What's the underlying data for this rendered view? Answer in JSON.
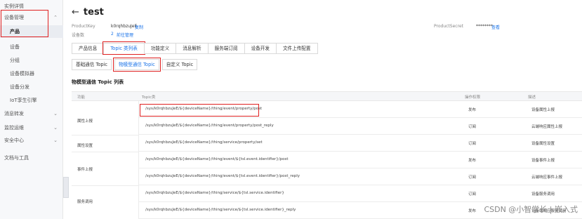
{
  "sidebar": {
    "items": [
      {
        "label": "实例详情"
      },
      {
        "label": "设备管理"
      },
      {
        "label": "产品"
      },
      {
        "label": "设备"
      },
      {
        "label": "分组"
      },
      {
        "label": "设备模拟器"
      },
      {
        "label": "设备分发"
      },
      {
        "label": "IoT孪生引擎"
      },
      {
        "label": "消息转发"
      },
      {
        "label": "监控运维"
      },
      {
        "label": "安全中心"
      },
      {
        "label": "文档与工具"
      }
    ]
  },
  "header": {
    "back_icon": "arrow-left-icon",
    "title": "test",
    "product_key_label": "ProductKey",
    "product_key_value": "k0rqhbzuJeE",
    "copy_label": "复制",
    "device_count_label": "设备数",
    "device_count_value": "2",
    "manage_label": "前往管理",
    "product_secret_label": "ProductSecret",
    "product_secret_value": "********",
    "view_label": "查看"
  },
  "tabs": [
    "产品信息",
    "Topic 类列表",
    "功能定义",
    "消息解析",
    "服务端订阅",
    "设备开发",
    "文件上传配置"
  ],
  "active_tab": 1,
  "subtabs": [
    "基础通信 Topic",
    "物模型通信 Topic",
    "自定义 Topic"
  ],
  "active_subtab": 1,
  "section_title": "物模型通信 Topic 列表",
  "table": {
    "columns": [
      "功能",
      "Topic类",
      "操作权限",
      "描述"
    ],
    "groups": [
      {
        "function": "属性上报",
        "rows": 2
      },
      {
        "function": "属性设置",
        "rows": 1
      },
      {
        "function": "事件上报",
        "rows": 2
      },
      {
        "function": "服务调用",
        "rows": 2
      }
    ],
    "rows": [
      {
        "topic": "/sys/k0rqhbzuJeE/${deviceName}/thing/event/property/post",
        "permission": "发布",
        "desc": "设备属性上报"
      },
      {
        "topic": "/sys/k0rqhbzuJeE/${deviceName}/thing/event/property/post_reply",
        "permission": "订阅",
        "desc": "云端响应属性上报"
      },
      {
        "topic": "/sys/k0rqhbzuJeE/${deviceName}/thing/service/property/set",
        "permission": "订阅",
        "desc": "设备属性设置"
      },
      {
        "topic": "/sys/k0rqhbzuJeE/${deviceName}/thing/event/${tsl.event.identifier}/post",
        "permission": "发布",
        "desc": "设备事件上报"
      },
      {
        "topic": "/sys/k0rqhbzuJeE/${deviceName}/thing/event/${tsl.event.identifier}/post_reply",
        "permission": "订阅",
        "desc": "云端响应事件上报"
      },
      {
        "topic": "/sys/k0rqhbzuJeE/${deviceName}/thing/service/${tsl.service.identifier}",
        "permission": "订阅",
        "desc": "设备服务调用"
      },
      {
        "topic": "/sys/k0rqhbzuJeE/${deviceName}/thing/service/${tsl.service.identifier}_reply",
        "permission": "发布",
        "desc": "设备端响应服务调用"
      }
    ]
  },
  "watermark": "CSDN @小智学长 | 嵌入式",
  "colors": {
    "accent": "#1a73e8",
    "highlight": "#e02020"
  }
}
